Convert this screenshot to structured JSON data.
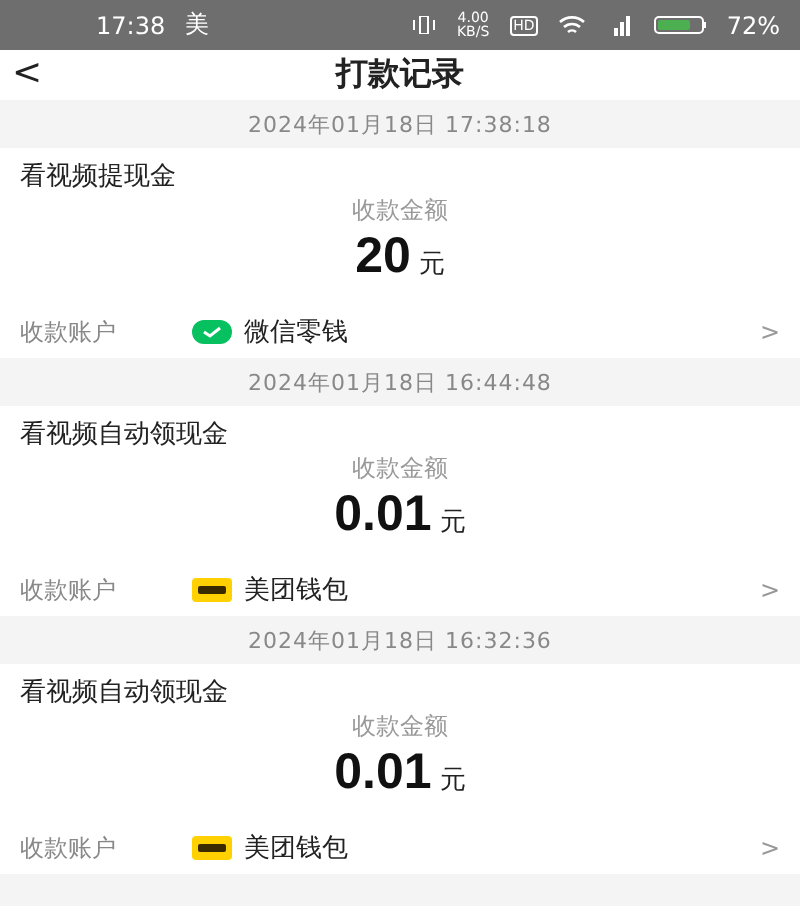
{
  "status_bar": {
    "time": "17:38",
    "notification": "美",
    "speed_value": "4.00",
    "speed_unit": "KB/S",
    "hd": "HD",
    "battery": "72%"
  },
  "header": {
    "back": "<",
    "title": "打款记录"
  },
  "records": [
    {
      "date": "2024年01月18日 17:38:18",
      "title": "看视频提现金",
      "amount_label": "收款金额",
      "amount": "20",
      "unit": "元",
      "account_label": "收款账户",
      "kind": "wechat",
      "wallet": "微信零钱",
      "chevron": ">"
    },
    {
      "date": "2024年01月18日 16:44:48",
      "title": "看视频自动领现金",
      "amount_label": "收款金额",
      "amount": "0.01",
      "unit": "元",
      "account_label": "收款账户",
      "kind": "meituan",
      "wallet": "美团钱包",
      "chevron": ">"
    },
    {
      "date": "2024年01月18日 16:32:36",
      "title": "看视频自动领现金",
      "amount_label": "收款金额",
      "amount": "0.01",
      "unit": "元",
      "account_label": "收款账户",
      "kind": "meituan",
      "wallet": "美团钱包",
      "chevron": ">"
    }
  ]
}
